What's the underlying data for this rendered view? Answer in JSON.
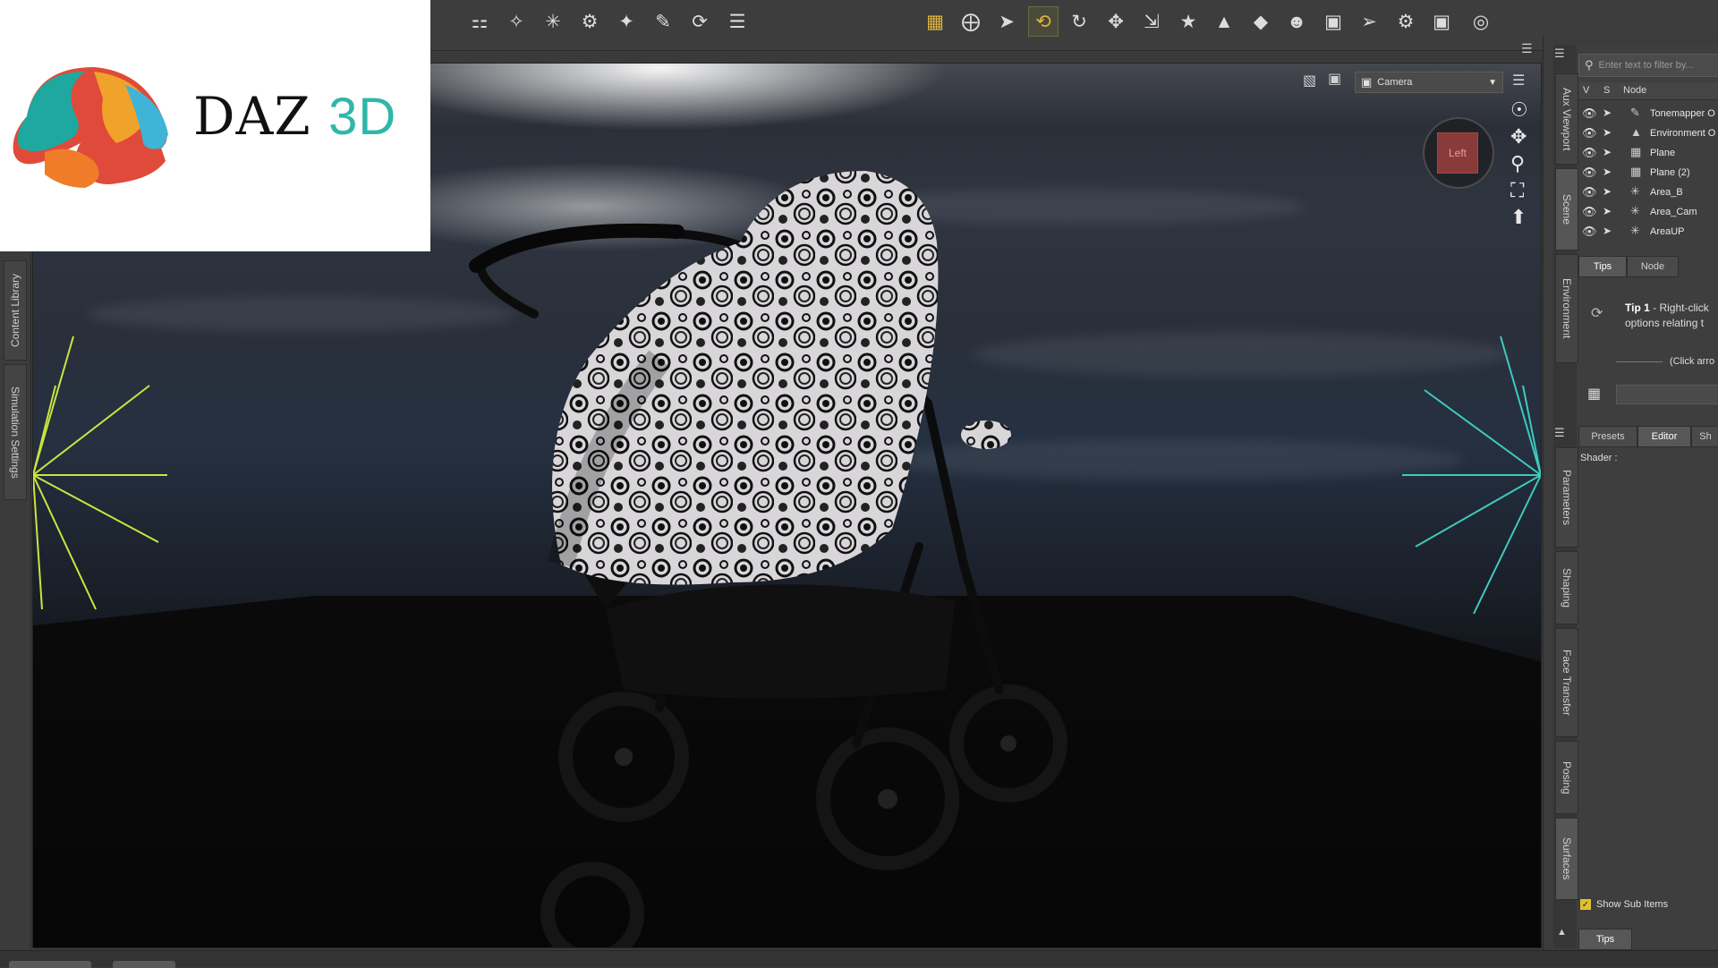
{
  "logo": {
    "brand": "DAZ",
    "brand_suffix": "3D"
  },
  "toolbar": {
    "icons": [
      "figure-add-icon",
      "wand-icon",
      "spark-icon",
      "clock-gear-icon",
      "wand-sparkle-icon",
      "paint-figure-icon",
      "rotate-dotted-icon",
      "list-menu-icon",
      "grid-icon",
      "node-select-icon",
      "pointer-icon",
      "universal-tool-icon",
      "rotate-icon",
      "move-icon",
      "scale-icon",
      "joint-icon",
      "morph-icon",
      "geometry-icon",
      "figure-tool-icon",
      "camera-plus-icon",
      "select-lasso-icon",
      "render-settings-icon",
      "render-camera-icon",
      "snapshot-icon"
    ]
  },
  "left_tabs": {
    "content_library": "Content Library",
    "simulation_settings": "Simulation Settings"
  },
  "viewport": {
    "camera": "Camera",
    "view_cube_label": "Left"
  },
  "right_vtabs": [
    "Aux Viewport",
    "Scene",
    "Environment",
    "Parameters",
    "Shaping",
    "Face Transfer",
    "Posing",
    "Surfaces"
  ],
  "scene": {
    "filter_placeholder": "Enter text to filter by...",
    "col_v": "V",
    "col_s": "S",
    "col_node": "Node",
    "rows": [
      {
        "icon": "tonemapper-icon",
        "name": "Tonemapper O"
      },
      {
        "icon": "environment-icon",
        "name": "Environment O"
      },
      {
        "icon": "plane-icon",
        "name": "Plane"
      },
      {
        "icon": "plane-icon",
        "name": "Plane (2)"
      },
      {
        "icon": "light-icon",
        "name": "Area_B"
      },
      {
        "icon": "light-icon",
        "name": "Area_Cam"
      },
      {
        "icon": "light-icon",
        "name": "AreaUP"
      }
    ]
  },
  "tips_panel": {
    "tab_tips": "Tips",
    "tab_node": "Node",
    "tip_number": "Tip 1",
    "tip_text": " - Right-click",
    "tip_text2": "options relating t",
    "click_arrow": "(Click arro"
  },
  "surfaces": {
    "tab_presets": "Presets",
    "tab_editor": "Editor",
    "tab_sh": "Sh",
    "shader_label": "Shader :",
    "show_sub_items": "Show Sub Items",
    "bottom_tab": "Tips"
  }
}
